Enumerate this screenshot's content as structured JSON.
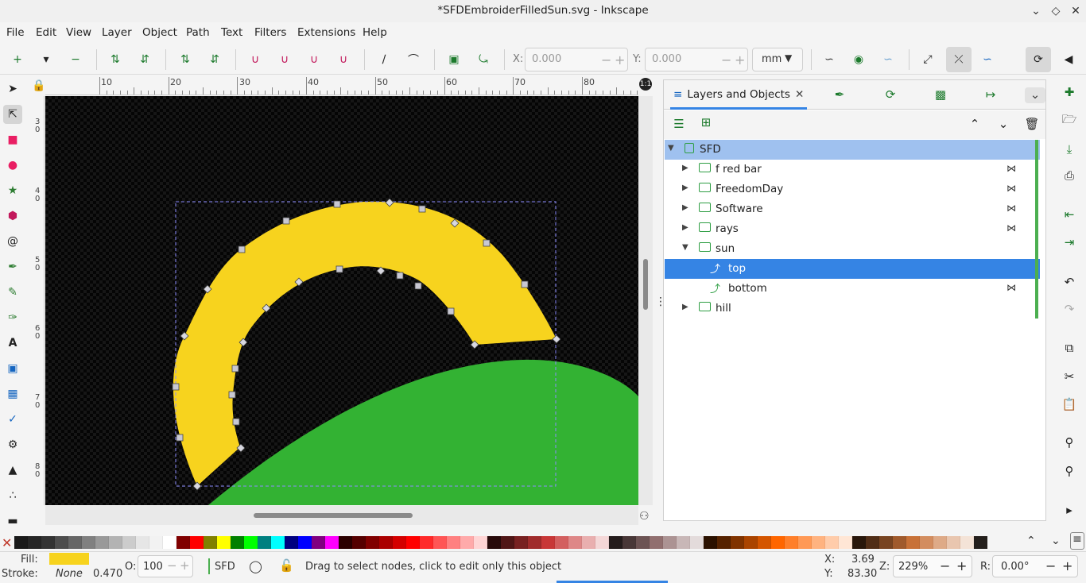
{
  "window": {
    "title": "*SFDEmbroiderFilledSun.svg - Inkscape"
  },
  "menu": [
    "File",
    "Edit",
    "View",
    "Layer",
    "Object",
    "Path",
    "Text",
    "Filters",
    "Extensions",
    "Help"
  ],
  "command_bar": {
    "x_label": "X:",
    "x_value": "0.000",
    "y_label": "Y:",
    "y_value": "0.000",
    "unit": "mm"
  },
  "ruler": {
    "h_labels": [
      "10",
      "20",
      "30",
      "40",
      "50",
      "60",
      "70",
      "80"
    ],
    "v_labels": [
      "3\n0",
      "4\n0",
      "5\n0",
      "6\n0",
      "7\n0",
      "8\n0"
    ]
  },
  "panel": {
    "active_tab": "Layers and Objects",
    "tree": [
      {
        "label": "SFD",
        "type": "layer",
        "expanded": true,
        "depth": 0,
        "selected_light": true
      },
      {
        "label": "f red bar",
        "type": "folder",
        "expanded": false,
        "depth": 1,
        "hidden_eye": true
      },
      {
        "label": "FreedomDay",
        "type": "folder",
        "expanded": false,
        "depth": 1,
        "hidden_eye": true
      },
      {
        "label": "Software",
        "type": "folder",
        "expanded": false,
        "depth": 1,
        "hidden_eye": true
      },
      {
        "label": "rays",
        "type": "folder",
        "expanded": false,
        "depth": 1,
        "hidden_eye": true
      },
      {
        "label": "sun",
        "type": "folder",
        "expanded": true,
        "depth": 1,
        "hidden_eye": false
      },
      {
        "label": "top",
        "type": "path",
        "depth": 2,
        "selected": true
      },
      {
        "label": "bottom",
        "type": "path",
        "depth": 2,
        "hidden_eye": true
      },
      {
        "label": "hill",
        "type": "folder",
        "expanded": false,
        "depth": 1,
        "hidden_eye": false
      }
    ]
  },
  "colors": {
    "sun": "#f7d31e",
    "hill": "#33b233",
    "accent": "#3584e4",
    "selected_row": "#3584e4",
    "layer_row": "#9fc1ef"
  },
  "palette": [
    "#1a1a1a",
    "#262626",
    "#333333",
    "#4d4d4d",
    "#666666",
    "#808080",
    "#999999",
    "#b3b3b3",
    "#cccccc",
    "#e6e6e6",
    "#f2f2f2",
    "#ffffff",
    "#800000",
    "#ff0000",
    "#808000",
    "#ffff00",
    "#008000",
    "#00ff00",
    "#008080",
    "#00ffff",
    "#000080",
    "#0000ff",
    "#800080",
    "#ff00ff",
    "#2b0000",
    "#550000",
    "#800000",
    "#aa0000",
    "#d40000",
    "#ff0000",
    "#ff2a2a",
    "#ff5555",
    "#ff8080",
    "#ffaaaa",
    "#ffd5d5",
    "#280b0b",
    "#501616",
    "#782121",
    "#a02c2c",
    "#c83737",
    "#d35f5f",
    "#de8787",
    "#e9afaf",
    "#f4d7d7",
    "#241c1c",
    "#483737",
    "#6c5353",
    "#916f6f",
    "#ac9393",
    "#c8b7b7",
    "#e3dbdb",
    "#2b1100",
    "#552200",
    "#803300",
    "#aa4400",
    "#d45500",
    "#ff6600",
    "#ff7f2a",
    "#ff9955",
    "#ffb380",
    "#ffccaa",
    "#ffe6d5",
    "#28170b",
    "#502d16",
    "#784421",
    "#a05a2c",
    "#c87137",
    "#d38d5f",
    "#deaa87",
    "#e9c6af",
    "#f4e3d7",
    "#241f1c"
  ],
  "status": {
    "fill_label": "Fill:",
    "stroke_label": "Stroke:",
    "stroke_value": "None",
    "stroke_width": "0.470",
    "opacity_label": "O:",
    "opacity_value": "100",
    "layer_name": "SFD",
    "message": "Drag to select nodes, click to edit only this object",
    "cursor_x_label": "X:",
    "cursor_x": "3.69",
    "cursor_y_label": "Y:",
    "cursor_y": "83.30",
    "zoom_label": "Z:",
    "zoom": "229%",
    "rotation_label": "R:",
    "rotation": "0.00°"
  },
  "icons": {
    "toolbox": [
      "selector-icon",
      "node-icon",
      "rect-icon",
      "ellipse-icon",
      "star-icon",
      "3dbox-icon",
      "spiral-icon",
      "pen-icon",
      "pencil-icon",
      "calligraphy-icon",
      "text-icon",
      "gradient-icon",
      "mesh-icon",
      "dropper-icon",
      "paintbucket-icon",
      "tweak-icon",
      "spray-icon",
      "eraser-icon"
    ]
  }
}
